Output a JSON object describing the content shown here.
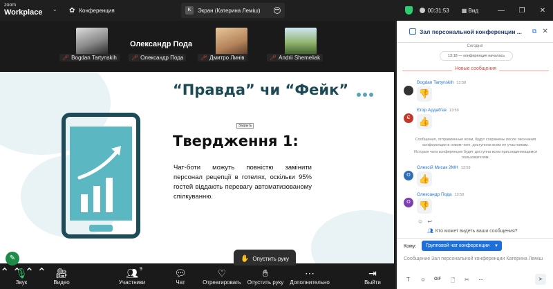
{
  "titlebar": {
    "brand_top": "zoom",
    "brand_bottom": "Workplace",
    "home_tab": "Конференция",
    "screen_tab": "Экран (Катерина Леміш)",
    "screen_tab_badge": "K",
    "timer": "00:31:53",
    "view_label": "Вид"
  },
  "gallery": {
    "speaker": "Олександр Пода",
    "participants": [
      {
        "name": "Bogdan Tartynskih"
      },
      {
        "name": "Олександр Пода"
      },
      {
        "name": "Дмитро Линів"
      },
      {
        "name": "Andrii Shemeliak"
      }
    ]
  },
  "slide": {
    "title": "“Правда” чи “Фейк”",
    "close_tip": "Закрыть",
    "heading": "Твердження 1:",
    "body": "Чат-боти можуть повністю замінити персонал рецепції в готелях, оскільки 95% гостей віддають перевагу автоматизованому спілкуванню."
  },
  "raise_hand": "Опустить руку",
  "toolbar": {
    "audio": "Звук",
    "video": "Видео",
    "participants": "Участники",
    "participants_count": "9",
    "chat": "Чат",
    "react": "Отреагировать",
    "lower_hand": "Опустить руку",
    "more": "Дополнительно",
    "leave": "Выйти"
  },
  "chat": {
    "title": "Зал персональной конференции ...",
    "today": "Сегодня",
    "started": "13:18 — конференция началась",
    "new_messages": "Новые сообщения",
    "messages": [
      {
        "name": "Bogdan Tartynskih",
        "time": "13:58",
        "reaction": "👎",
        "avatar": ""
      },
      {
        "name": "Єгор Ардаб'єв",
        "time": "13:59",
        "reaction": "👍",
        "avatar": "Є"
      },
      {
        "name": "Олексій Мисак 2МН",
        "time": "13:59",
        "reaction": "👍",
        "avatar": "О"
      },
      {
        "name": "Олександр Пода",
        "time": "13:59",
        "reaction": "👎",
        "avatar": "О"
      }
    ],
    "system_1": "Сообщения, отправленные всем, будут сохранены после окончания конференции в новом чате, доступном всем ее участникам.",
    "system_2": "История чата конференции будет доступна всем присоединяющимся пользователям.",
    "privacy": "Кто может видеть ваши сообщения?",
    "to_label": "Кому:",
    "to_value": "Групповой чат конференции",
    "compose_placeholder": "Сообщение Зал персональной конференции Катерина Леміш",
    "colors": {
      "accent": "#1e6fd8",
      "new_msg": "#e0443a"
    }
  }
}
